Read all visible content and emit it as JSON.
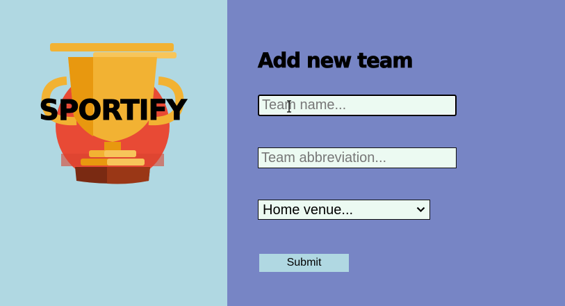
{
  "brand": {
    "logo_text": "SPORTIFY",
    "logo_icon": "trophy-icon"
  },
  "form": {
    "title": "Add new team",
    "team_name_placeholder": "Team name...",
    "team_name_value": "",
    "team_abbr_placeholder": "Team abbreviation...",
    "team_abbr_value": "",
    "venue_selected": "Home venue...",
    "submit_label": "Submit"
  },
  "colors": {
    "left_bg": "#b0d8e2",
    "right_bg": "#7785c5",
    "field_bg": "#ecfaf2",
    "button_bg": "#b0d8e2",
    "logo_circle": "#e84a35",
    "trophy_gold": "#f2b233"
  }
}
